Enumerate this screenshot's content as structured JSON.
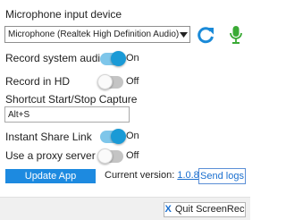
{
  "mic": {
    "section_label": "Microphone input device",
    "selected_device": "Microphone (Realtek High Definition Audio)"
  },
  "record_system_audio": {
    "label": "Record system audio",
    "state": "On"
  },
  "record_hd": {
    "label": "Record in HD",
    "state": "Off"
  },
  "shortcut": {
    "label": "Shortcut Start/Stop Capture",
    "value": "Alt+S"
  },
  "instant_share": {
    "label": "Instant Share Link",
    "state": "On"
  },
  "proxy": {
    "label": "Use a proxy server",
    "state": "Off"
  },
  "update": {
    "button_label": "Update App",
    "version_prefix": "Current version:",
    "version": "1.0.83",
    "send_logs_label": "Send logs"
  },
  "footer": {
    "quit_label": "Quit ScreenRec",
    "quit_icon_glyph": "X"
  },
  "colors": {
    "accent": "#1d8ae0",
    "toggle_on_track": "#7ec6ea",
    "toggle_on_knob": "#1a9ad6",
    "refresh_icon": "#1a8ad8",
    "mic_icon": "#3aaa35"
  }
}
